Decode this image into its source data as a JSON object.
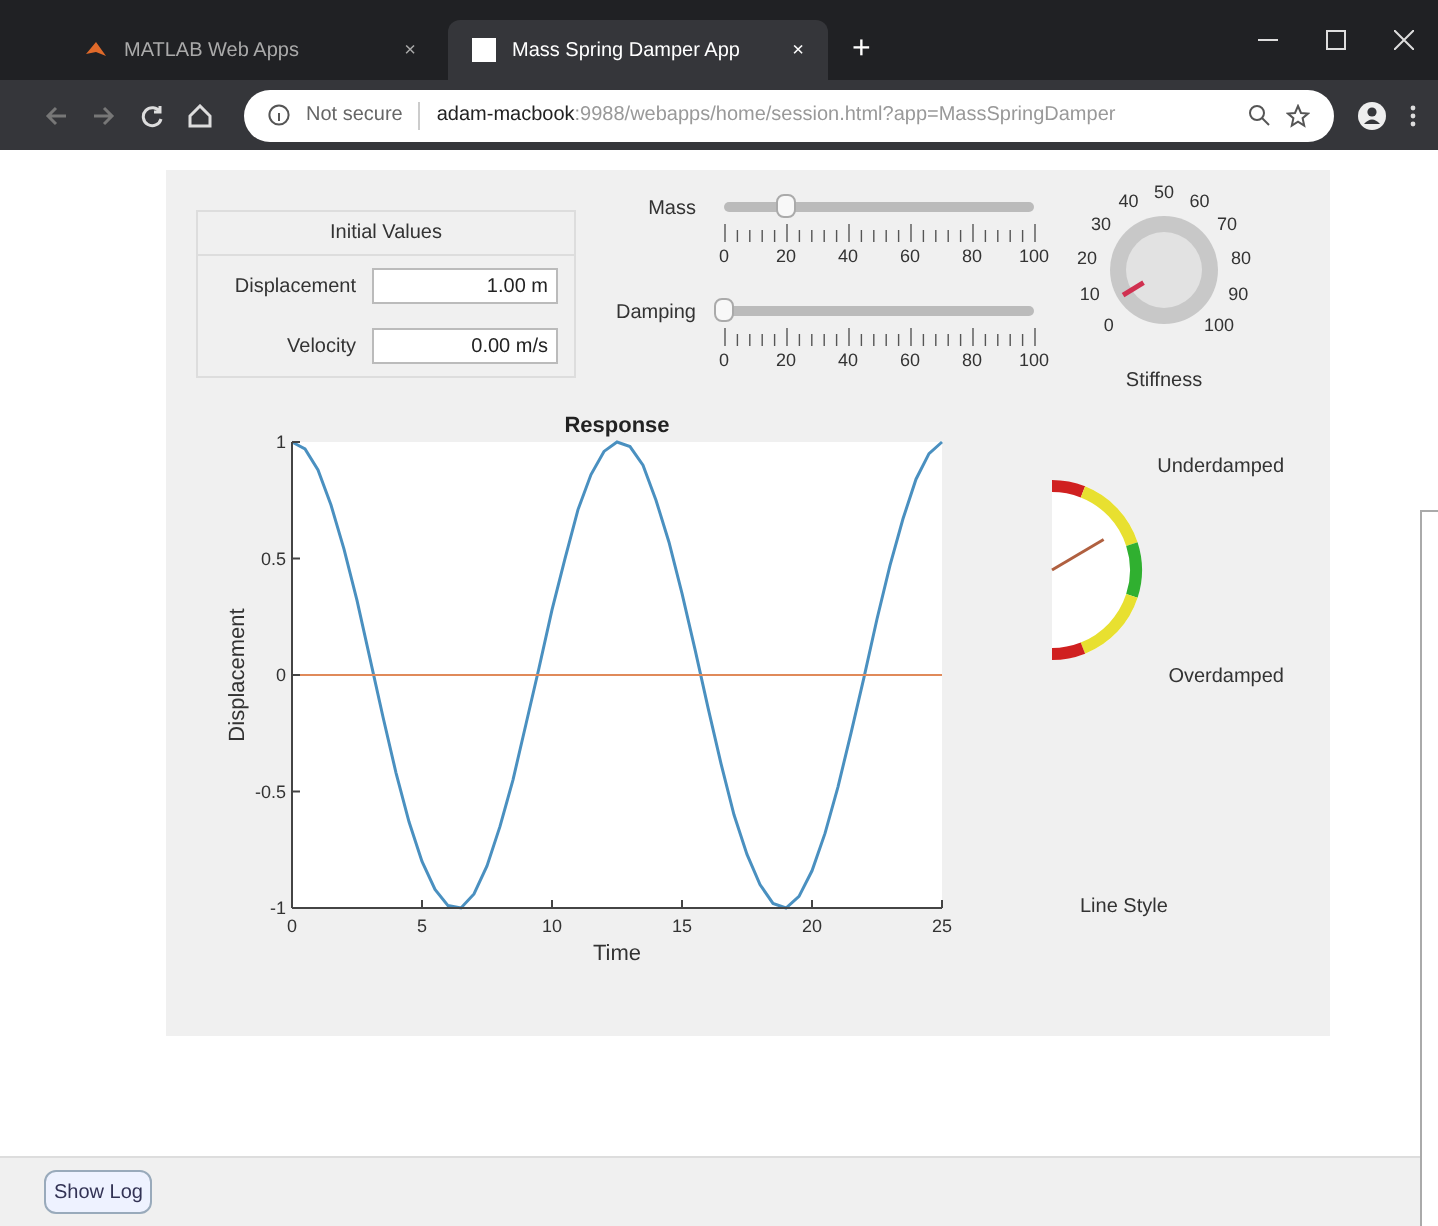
{
  "browser": {
    "tabs": [
      {
        "title": "MATLAB Web Apps",
        "selected": false,
        "close": "×"
      },
      {
        "title": "Mass Spring Damper App",
        "selected": true,
        "close": "×"
      }
    ],
    "new_tab": "+",
    "address": {
      "security": "Not secure",
      "host": "adam-macbook",
      "path": ":9988/webapps/home/session.html?app=MassSpringDamper"
    }
  },
  "initial_values": {
    "title": "Initial Values",
    "fields": [
      {
        "label": "Displacement",
        "value": "1.00 m"
      },
      {
        "label": "Velocity",
        "value": "0.00 m/s"
      }
    ]
  },
  "sliders": [
    {
      "label": "Mass",
      "level": 0.2,
      "ticks": [
        "0",
        "20",
        "40",
        "60",
        "80",
        "100"
      ]
    },
    {
      "label": "Damping",
      "level": 0,
      "ticks": [
        "0",
        "20",
        "40",
        "60",
        "80",
        "100"
      ]
    }
  ],
  "knob": {
    "label": "Stiffness",
    "ticks": [
      "0",
      "10",
      "20",
      "30",
      "40",
      "50",
      "60",
      "70",
      "80",
      "90",
      "100"
    ]
  },
  "chart": {
    "chart_data": {
      "type": "line",
      "title": "Response",
      "xlabel": "Time",
      "ylabel": "Displacement",
      "xlim": [
        0,
        25
      ],
      "ylim": [
        -1,
        1
      ],
      "xticks": [
        0,
        5,
        10,
        15,
        20,
        25
      ],
      "yticks": [
        -1,
        -0.5,
        0,
        0.5,
        1
      ],
      "x": [
        0,
        0.5,
        1,
        1.5,
        2,
        2.5,
        3,
        3.5,
        4,
        4.5,
        5,
        5.5,
        6,
        6.5,
        7,
        7.5,
        8,
        8.5,
        9,
        9.5,
        10,
        10.5,
        11,
        11.5,
        12,
        12.5,
        13,
        13.5,
        14,
        14.5,
        15,
        15.5,
        16,
        16.5,
        17,
        17.5,
        18,
        18.5,
        19,
        19.5,
        20,
        20.5,
        21,
        21.5,
        22,
        22.5,
        23,
        23.5,
        24,
        24.5,
        25
      ],
      "series": [
        {
          "color": "#4a90c0",
          "values": [
            1,
            0.97,
            0.88,
            0.73,
            0.54,
            0.32,
            0.07,
            -0.18,
            -0.42,
            -0.63,
            -0.8,
            -0.92,
            -0.99,
            -1,
            -0.94,
            -0.82,
            -0.65,
            -0.45,
            -0.21,
            0.03,
            0.28,
            0.5,
            0.71,
            0.86,
            0.96,
            1,
            0.98,
            0.9,
            0.75,
            0.57,
            0.35,
            0.11,
            -0.14,
            -0.38,
            -0.6,
            -0.77,
            -0.9,
            -0.98,
            -1,
            -0.95,
            -0.84,
            -0.68,
            -0.48,
            -0.25,
            -0.01,
            0.24,
            0.47,
            0.67,
            0.84,
            0.95,
            1
          ]
        },
        {
          "color": "#e08a5a",
          "values": [
            0,
            0,
            0,
            0,
            0,
            0,
            0,
            0,
            0,
            0,
            0,
            0,
            0,
            0,
            0,
            0,
            0,
            0,
            0,
            0,
            0,
            0,
            0,
            0,
            0,
            0,
            0,
            0,
            0,
            0,
            0,
            0,
            0,
            0,
            0,
            0,
            0,
            0,
            0,
            0,
            0,
            0,
            0,
            0,
            0,
            0,
            0,
            0,
            0,
            0,
            0
          ]
        }
      ]
    }
  },
  "gauge": {
    "top_label": "Underdamped",
    "bottom_label": "Overdamped"
  },
  "line_style": {
    "label": "Line Style"
  },
  "footer": {
    "button": "Show Log"
  }
}
